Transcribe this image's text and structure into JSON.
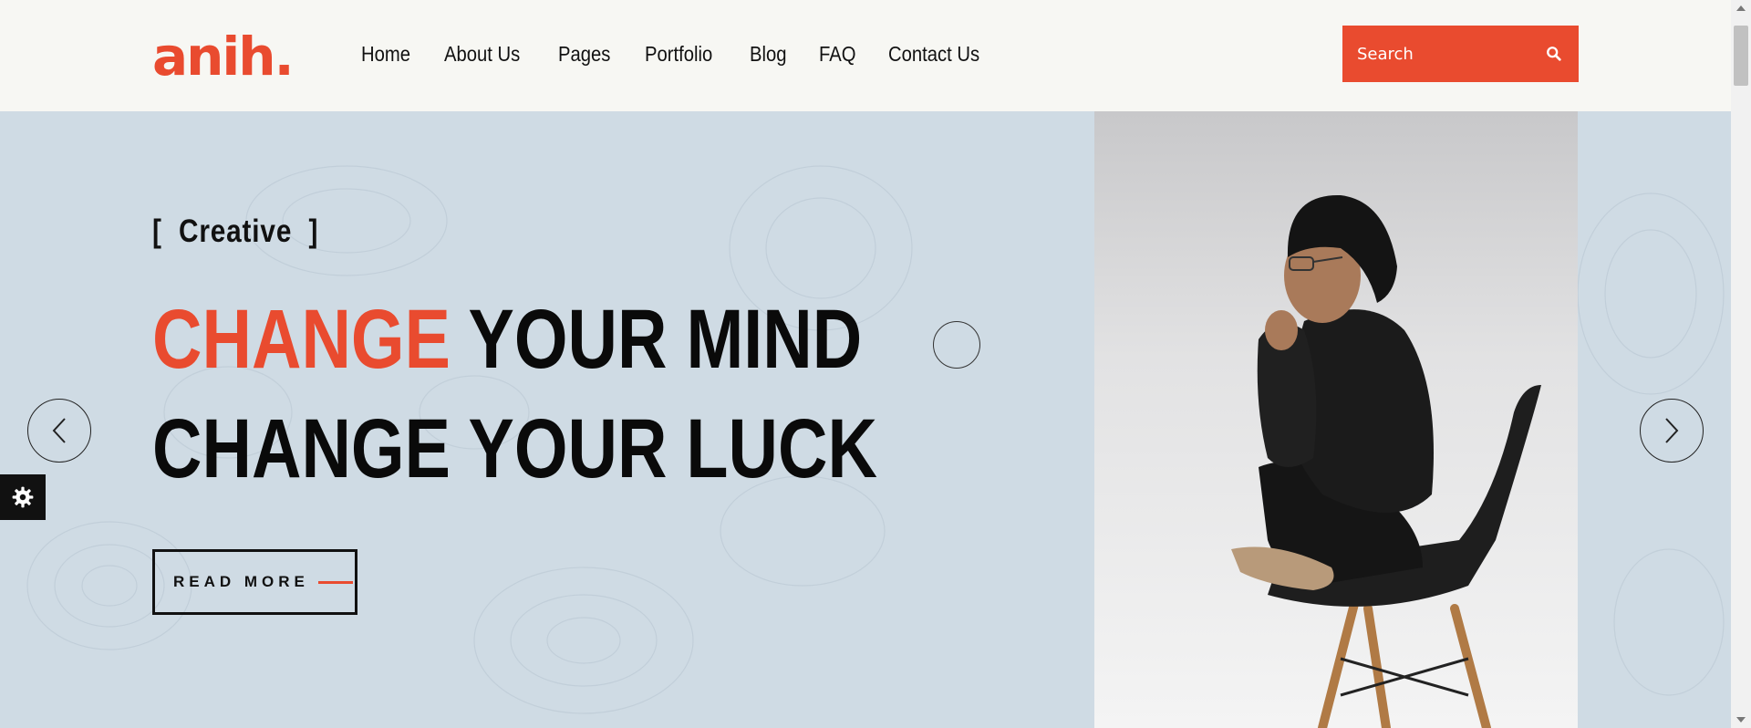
{
  "brand": {
    "logo_text": "anih.",
    "accent_color": "#e94b2f"
  },
  "nav": {
    "items": [
      {
        "label": "Home"
      },
      {
        "label": "About Us"
      },
      {
        "label": "Pages"
      },
      {
        "label": "Portfolio"
      },
      {
        "label": "Blog"
      },
      {
        "label": "FAQ"
      },
      {
        "label": "Contact Us"
      }
    ]
  },
  "search": {
    "placeholder": "Search",
    "icon": "search-icon"
  },
  "hero": {
    "tag_open": "[",
    "tag_text": "Creative",
    "tag_close": "]",
    "line1_accent": "CHANGE",
    "line1_rest": " YOUR MIND",
    "line2": "CHANGE YOUR LUCK",
    "read_more_label": "READ MORE",
    "background_color": "#cfdbe4",
    "image_subject": "man in black beanie sitting on chair"
  },
  "slider": {
    "prev_icon": "chevron-left-icon",
    "next_icon": "chevron-right-icon"
  },
  "settings": {
    "icon": "gear-icon"
  }
}
